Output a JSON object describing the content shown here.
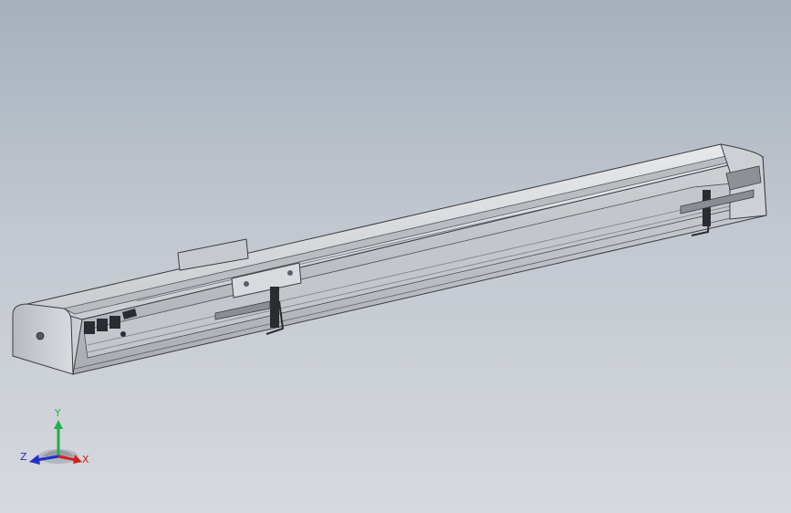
{
  "viewport": {
    "background_top": "#a6b0bd",
    "background_bottom": "#d6d9de"
  },
  "model": {
    "body_color": "#d4d7db",
    "edge_color": "#3a3d42",
    "dark_parts_color": "#2a2c2f"
  },
  "triad": {
    "x_label": "X",
    "y_label": "Y",
    "z_label": "Z",
    "x_color": "#d42020",
    "y_color": "#21b04a",
    "z_color": "#2230c8"
  }
}
